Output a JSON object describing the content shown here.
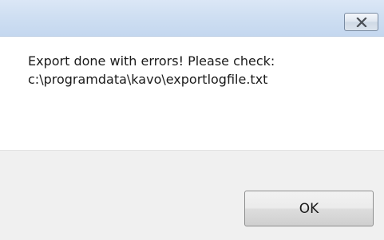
{
  "window": {
    "close_icon": "close-icon"
  },
  "message": {
    "line1": "Export done with errors! Please check:",
    "line2": "c:\\programdata\\kavo\\exportlogfile.txt"
  },
  "buttons": {
    "ok_label": "OK"
  }
}
